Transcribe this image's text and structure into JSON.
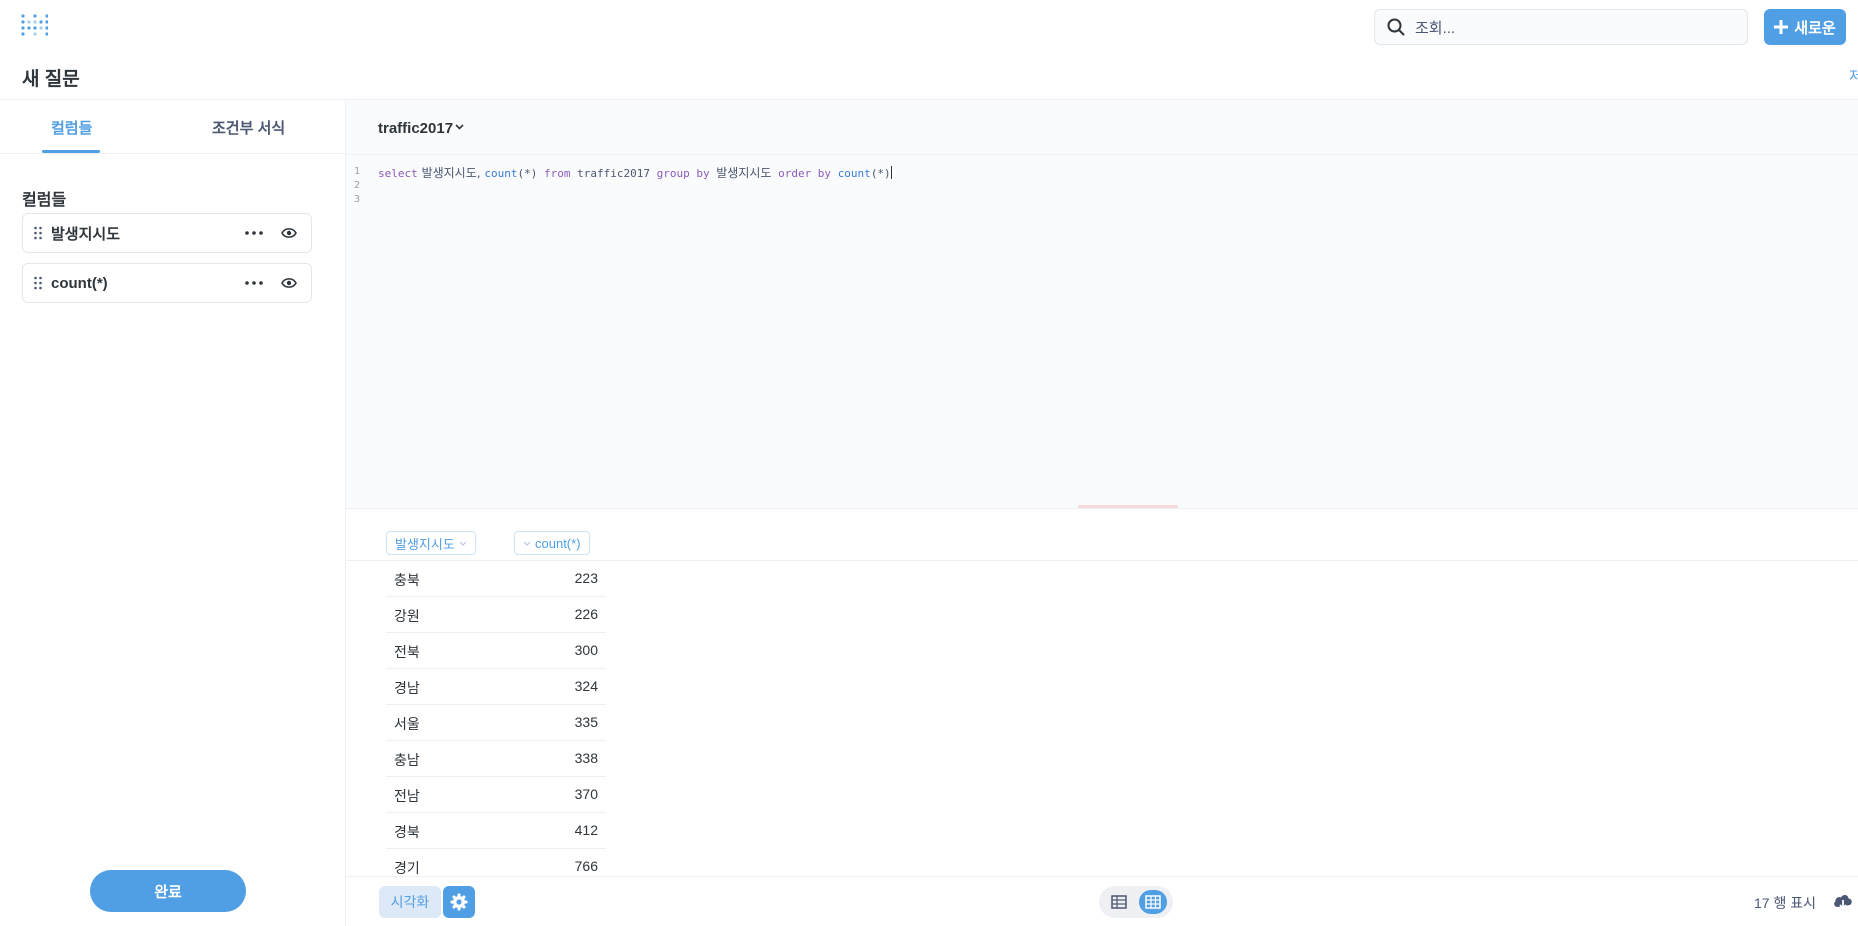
{
  "header": {
    "search_placeholder": "조회...",
    "new_button": "새로운"
  },
  "page": {
    "title": "새 질문",
    "edge_text": "저"
  },
  "sidebar": {
    "tabs": [
      {
        "label": "컬럼들",
        "active": true
      },
      {
        "label": "조건부 서식",
        "active": false
      }
    ],
    "section_title": "컬럼들",
    "columns": [
      {
        "label": "발생지시도"
      },
      {
        "label": "count(*)"
      }
    ],
    "done_button": "완료"
  },
  "editor": {
    "database": "traffic2017",
    "line_numbers": [
      "1",
      "2",
      "3"
    ],
    "query_tokens": {
      "select": "select",
      "col": " 발생지시도, ",
      "count1": "count",
      "star1": "(*)",
      "from": " from ",
      "table": "traffic2017",
      "group_by": " group by ",
      "col2": "발생지시도",
      "order_by": " order by ",
      "count2": "count",
      "star2": "(*)"
    }
  },
  "results": {
    "columns": [
      "발생지시도",
      "count(*)"
    ],
    "rows": [
      [
        "충북",
        "223"
      ],
      [
        "강원",
        "226"
      ],
      [
        "전북",
        "300"
      ],
      [
        "경남",
        "324"
      ],
      [
        "서울",
        "335"
      ],
      [
        "충남",
        "338"
      ],
      [
        "전남",
        "370"
      ],
      [
        "경북",
        "412"
      ],
      [
        "경기",
        "766"
      ]
    ]
  },
  "footer": {
    "visualize_button": "시각화",
    "row_count": "17 행 표시"
  },
  "colors": {
    "accent": "#509ee3",
    "text_dark": "#2e353b",
    "text_medium": "#4c5773"
  }
}
